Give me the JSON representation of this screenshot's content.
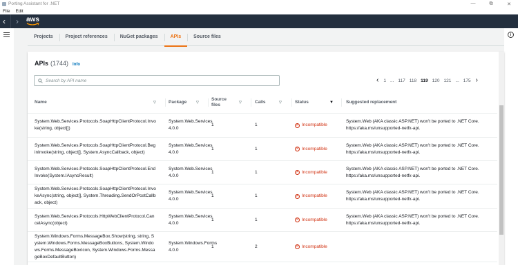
{
  "window": {
    "title": "Porting Assistant for .NET"
  },
  "menu": {
    "file": "File",
    "edit": "Edit"
  },
  "nav": {
    "logo": "aws"
  },
  "window_controls": {
    "minimize": "—",
    "maximize": "⧉",
    "close": "✕"
  },
  "tabs": [
    {
      "label": "Projects"
    },
    {
      "label": "Project references"
    },
    {
      "label": "NuGet packages"
    },
    {
      "label": "APIs",
      "active": true
    },
    {
      "label": "Source files"
    }
  ],
  "panel": {
    "title": "APIs",
    "count": "(1744)",
    "info_link": "Info",
    "search_placeholder": "Search by API name"
  },
  "pagination": {
    "prev": "‹",
    "next": "›",
    "pages": [
      "1",
      "...",
      "117",
      "118",
      "119",
      "120",
      "121",
      "...",
      "175"
    ],
    "current": "119"
  },
  "columns": {
    "name": "Name",
    "package": "Package",
    "source_files": "Source files",
    "calls": "Calls",
    "status": "Status",
    "replacement": "Suggested replacement"
  },
  "rows": [
    {
      "name": "System.Web.Services.Protocols.SoapHttpClientProtocol.Invoke(string, object[])",
      "package": "System.Web.Services 4.0.0",
      "source_files": "1",
      "calls": "1",
      "status": "Incompatible",
      "replacement": "System.Web (AKA classic ASP.NET) won't be ported to .NET Core. https://aka.ms/unsupported-netfx-api."
    },
    {
      "name": "System.Web.Services.Protocols.SoapHttpClientProtocol.BeginInvoke(string, object[], System.AsyncCallback, object)",
      "package": "System.Web.Services 4.0.0",
      "source_files": "1",
      "calls": "1",
      "status": "Incompatible",
      "replacement": "System.Web (AKA classic ASP.NET) won't be ported to .NET Core. https://aka.ms/unsupported-netfx-api."
    },
    {
      "name": "System.Web.Services.Protocols.SoapHttpClientProtocol.EndInvoke(System.IAsyncResult)",
      "package": "System.Web.Services 4.0.0",
      "source_files": "1",
      "calls": "1",
      "status": "Incompatible",
      "replacement": "System.Web (AKA classic ASP.NET) won't be ported to .NET Core. https://aka.ms/unsupported-netfx-api."
    },
    {
      "name": "System.Web.Services.Protocols.SoapHttpClientProtocol.InvokeAsync(string, object[], System.Threading.SendOrPostCallback, object)",
      "package": "System.Web.Services 4.0.0",
      "source_files": "1",
      "calls": "1",
      "status": "Incompatible",
      "replacement": "System.Web (AKA classic ASP.NET) won't be ported to .NET Core. https://aka.ms/unsupported-netfx-api."
    },
    {
      "name": "System.Web.Services.Protocols.HttpWebClientProtocol.CancelAsync(object)",
      "package": "System.Web.Services 4.0.0",
      "source_files": "1",
      "calls": "1",
      "status": "Incompatible",
      "replacement": "System.Web (AKA classic ASP.NET) won't be ported to .NET Core. https://aka.ms/unsupported-netfx-api."
    },
    {
      "name": "System.Windows.Forms.MessageBox.Show(string, string, System.Windows.Forms.MessageBoxButtons, System.Windows.Forms.MessageBoxIcon, System.Windows.Forms.MessageBoxDefaultButton)",
      "package": "System.Windows.Forms 4.0.0",
      "source_files": "1",
      "calls": "2",
      "status": "Incompatible",
      "replacement": ""
    }
  ],
  "colors": {
    "accent": "#ec7211",
    "incompatible": "#d13212",
    "nav": "#232f3e",
    "link": "#0073bb"
  }
}
